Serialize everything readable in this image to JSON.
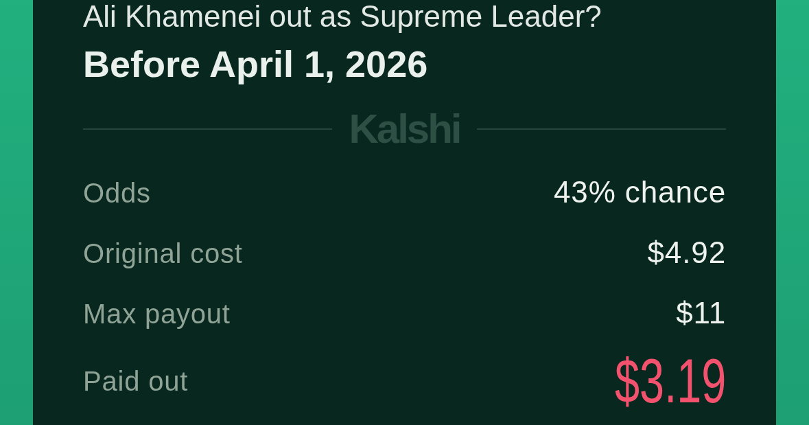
{
  "card": {
    "question": "Ali Khamenei out as Supreme Leader?",
    "title": "Before April 1, 2026",
    "brand": "Kalshi",
    "rows": [
      {
        "kind": "plain",
        "label": "Odds",
        "value": "43% chance"
      },
      {
        "kind": "plain",
        "label": "Original cost",
        "value": "$4.92"
      },
      {
        "kind": "plain",
        "label": "Max payout",
        "value": "$11"
      },
      {
        "kind": "highlight",
        "label": "Paid out",
        "value": "$3.19"
      }
    ]
  }
}
